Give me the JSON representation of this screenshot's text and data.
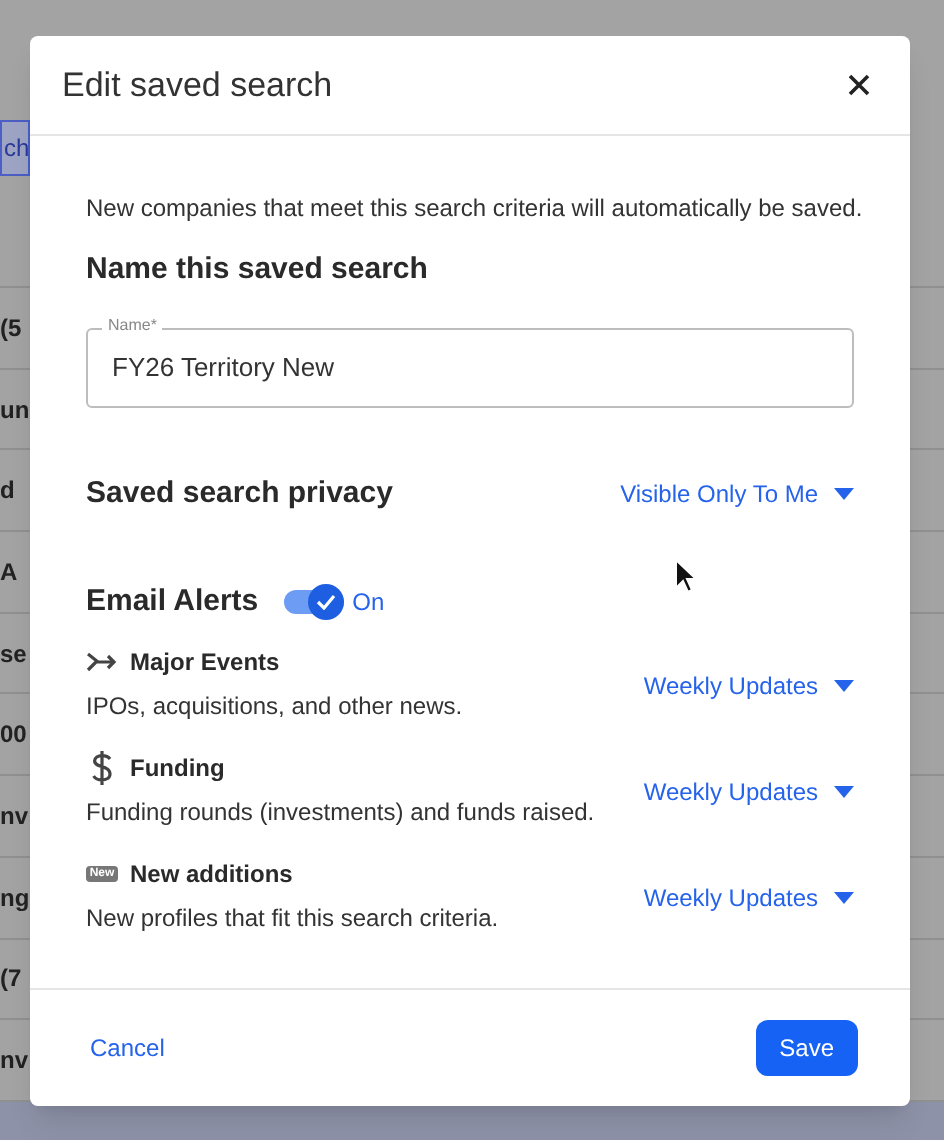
{
  "background": {
    "tab": "ch",
    "rows": [
      "(5",
      "un",
      "d",
      "A",
      "se",
      "00",
      "nv",
      "ng",
      "(7",
      "nv"
    ]
  },
  "dialog": {
    "title": "Edit saved search",
    "intro": "New companies that meet this search criteria will automatically be saved.",
    "name_heading": "Name this saved search",
    "name_field": {
      "label": "Name*",
      "value": "FY26 Territory New"
    },
    "privacy": {
      "label": "Saved search privacy",
      "value": "Visible Only To Me"
    },
    "email_alerts": {
      "label": "Email Alerts",
      "on": true,
      "state_text": "On"
    },
    "alerts": [
      {
        "kind": "events",
        "title": "Major Events",
        "description": "IPOs, acquisitions, and other news.",
        "frequency": "Weekly Updates"
      },
      {
        "kind": "funding",
        "title": "Funding",
        "description": "Funding rounds (investments) and funds raised.",
        "frequency": "Weekly Updates"
      },
      {
        "kind": "new",
        "badge": "New",
        "title": "New additions",
        "description": "New profiles that fit this search criteria.",
        "frequency": "Weekly Updates"
      }
    ],
    "buttons": {
      "cancel": "Cancel",
      "save": "Save"
    }
  }
}
